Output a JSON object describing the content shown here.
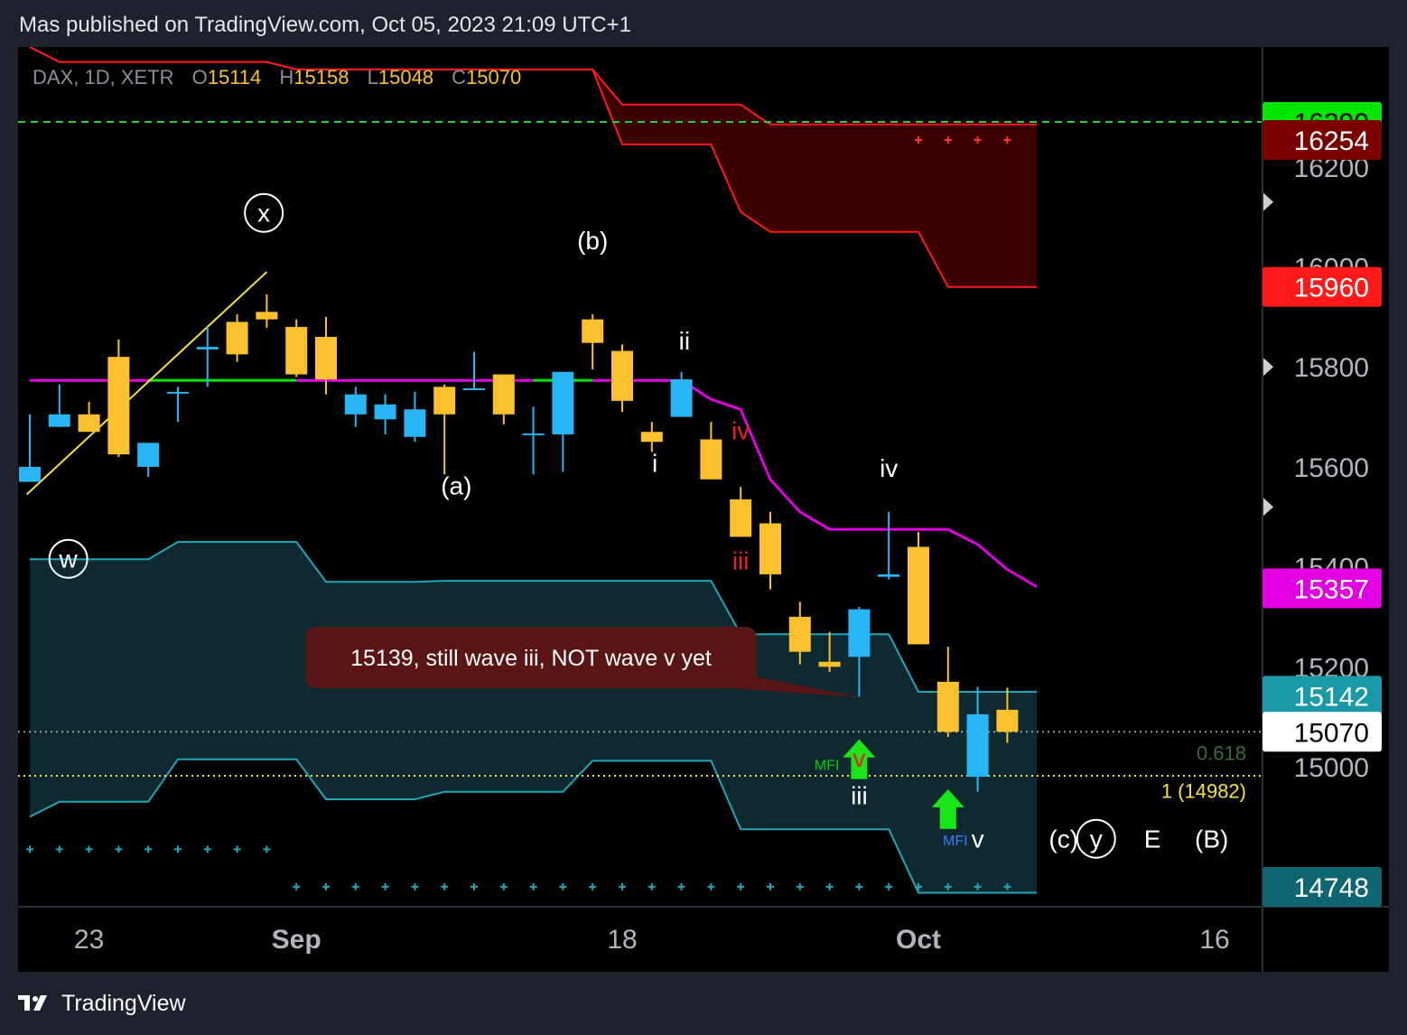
{
  "header": {
    "published": "Mas published on TradingView.com, Oct 05, 2023 21:09 UTC+1"
  },
  "legend": {
    "symbol": "DAX, 1D, XETR",
    "open_label": "O",
    "open": "15114",
    "high_label": "H",
    "high": "15158",
    "low_label": "L",
    "low": "15048",
    "close_label": "C",
    "close": "15070"
  },
  "footer": {
    "brand": "TradingView",
    "logo_icon": "tradingview-logo-icon"
  },
  "colors": {
    "bull": "#29b6f6",
    "bear": "#fbc02d",
    "cloud_top": "#3d0000",
    "cloud_bottom": "#0e2a30",
    "kijun": "#e100e1",
    "tenkan_green": "#00e600",
    "upper_line": "#ff1a1a",
    "lower_line": "#1ea7b8",
    "dashed_green": "#2ecc40",
    "fib_yellow": "#f5e23a"
  },
  "chart_data": {
    "type": "candlestick",
    "symbol": "DAX",
    "timeframe": "1D",
    "exchange": "XETR",
    "ylim": [
      14720,
      16440
    ],
    "y_ticks": [
      15000,
      15200,
      15400,
      15600,
      15800,
      16000,
      16200
    ],
    "x_ticks": [
      {
        "label": "23",
        "index": 2
      },
      {
        "label": "Sep",
        "index": 9
      },
      {
        "label": "18",
        "index": 20
      },
      {
        "label": "Oct",
        "index": 30
      },
      {
        "label": "16",
        "index": 40
      }
    ],
    "candles": [
      {
        "o": 15570,
        "h": 15705,
        "l": 15570,
        "c": 15600
      },
      {
        "o": 15680,
        "h": 15765,
        "l": 15680,
        "c": 15705
      },
      {
        "o": 15705,
        "h": 15730,
        "l": 15675,
        "c": 15670
      },
      {
        "o": 15820,
        "h": 15855,
        "l": 15620,
        "c": 15625
      },
      {
        "o": 15600,
        "h": 15620,
        "l": 15580,
        "c": 15648
      },
      {
        "o": 15750,
        "h": 15760,
        "l": 15690,
        "c": 15750
      },
      {
        "o": 15835,
        "h": 15880,
        "l": 15760,
        "c": 15840
      },
      {
        "o": 15890,
        "h": 15905,
        "l": 15810,
        "c": 15825
      },
      {
        "o": 15910,
        "h": 15945,
        "l": 15878,
        "c": 15895
      },
      {
        "o": 15880,
        "h": 15895,
        "l": 15780,
        "c": 15785
      },
      {
        "o": 15860,
        "h": 15900,
        "l": 15745,
        "c": 15775
      },
      {
        "o": 15705,
        "h": 15760,
        "l": 15680,
        "c": 15745
      },
      {
        "o": 15695,
        "h": 15745,
        "l": 15665,
        "c": 15725
      },
      {
        "o": 15660,
        "h": 15750,
        "l": 15650,
        "c": 15715
      },
      {
        "o": 15760,
        "h": 15765,
        "l": 15585,
        "c": 15705
      },
      {
        "o": 15755,
        "h": 15830,
        "l": 15755,
        "c": 15757
      },
      {
        "o": 15785,
        "h": 15785,
        "l": 15685,
        "c": 15705
      },
      {
        "o": 15665,
        "h": 15720,
        "l": 15585,
        "c": 15667
      },
      {
        "o": 15665,
        "h": 15780,
        "l": 15590,
        "c": 15790
      },
      {
        "o": 15895,
        "h": 15905,
        "l": 15795,
        "c": 15848
      },
      {
        "o": 15832,
        "h": 15845,
        "l": 15710,
        "c": 15732
      },
      {
        "o": 15670,
        "h": 15690,
        "l": 15630,
        "c": 15650
      },
      {
        "o": 15700,
        "h": 15790,
        "l": 15700,
        "c": 15775
      },
      {
        "o": 15655,
        "h": 15690,
        "l": 15600,
        "c": 15575
      },
      {
        "o": 15535,
        "h": 15560,
        "l": 15460,
        "c": 15460
      },
      {
        "o": 15487,
        "h": 15510,
        "l": 15355,
        "c": 15385
      },
      {
        "o": 15300,
        "h": 15330,
        "l": 15205,
        "c": 15230
      },
      {
        "o": 15210,
        "h": 15270,
        "l": 15190,
        "c": 15200
      },
      {
        "o": 15220,
        "h": 15320,
        "l": 15140,
        "c": 15315
      },
      {
        "o": 15380,
        "h": 15510,
        "l": 15375,
        "c": 15385
      },
      {
        "o": 15440,
        "h": 15470,
        "l": 15250,
        "c": 15245
      },
      {
        "o": 15170,
        "h": 15240,
        "l": 15060,
        "c": 15070
      },
      {
        "o": 14980,
        "h": 15160,
        "l": 14950,
        "c": 15105
      },
      {
        "o": 15114,
        "h": 15158,
        "l": 15048,
        "c": 15070
      }
    ],
    "tenkan_line": {
      "green_segments": [
        [
          4,
          9
        ],
        [
          17,
          19
        ]
      ]
    },
    "kijun_line": {
      "values": [
        [
          0,
          15773
        ],
        [
          1,
          15773
        ],
        [
          2,
          15773
        ],
        [
          3,
          15773
        ],
        [
          4,
          15773
        ],
        [
          5,
          15773
        ],
        [
          6,
          15773
        ],
        [
          7,
          15773
        ],
        [
          8,
          15773
        ],
        [
          9,
          15773
        ],
        [
          10,
          15773
        ],
        [
          11,
          15773
        ],
        [
          12,
          15773
        ],
        [
          13,
          15773
        ],
        [
          14,
          15773
        ],
        [
          15,
          15773
        ],
        [
          16,
          15773
        ],
        [
          17,
          15773
        ],
        [
          18,
          15773
        ],
        [
          19,
          15773
        ],
        [
          20,
          15773
        ],
        [
          21,
          15773
        ],
        [
          22,
          15773
        ],
        [
          23,
          15735
        ],
        [
          24,
          15715
        ],
        [
          25,
          15575
        ],
        [
          26,
          15510
        ],
        [
          27,
          15475
        ],
        [
          28,
          15475
        ],
        [
          29,
          15475
        ],
        [
          30,
          15475
        ],
        [
          31,
          15475
        ],
        [
          32,
          15445
        ],
        [
          33,
          15395
        ],
        [
          34,
          15360
        ]
      ]
    },
    "upper_band": {
      "upper": [
        [
          0,
          16440
        ],
        [
          1,
          16410
        ],
        [
          2,
          16410
        ],
        [
          3,
          16410
        ],
        [
          4,
          16410
        ],
        [
          5,
          16410
        ],
        [
          6,
          16410
        ],
        [
          7,
          16410
        ],
        [
          8,
          16410
        ],
        [
          9,
          16395
        ],
        [
          10,
          16395
        ],
        [
          11,
          16395
        ],
        [
          12,
          16395
        ],
        [
          13,
          16395
        ],
        [
          14,
          16395
        ],
        [
          15,
          16395
        ],
        [
          16,
          16395
        ],
        [
          17,
          16395
        ],
        [
          18,
          16395
        ],
        [
          19,
          16395
        ],
        [
          20,
          16325
        ],
        [
          21,
          16325
        ],
        [
          22,
          16325
        ],
        [
          23,
          16325
        ],
        [
          24,
          16325
        ],
        [
          25,
          16285
        ],
        [
          26,
          16285
        ],
        [
          27,
          16285
        ],
        [
          28,
          16285
        ],
        [
          29,
          16285
        ],
        [
          30,
          16285
        ],
        [
          31,
          16285
        ],
        [
          32,
          16285
        ],
        [
          33,
          16285
        ],
        [
          34,
          16285
        ]
      ],
      "lower": [
        [
          0,
          16440
        ],
        [
          1,
          16410
        ],
        [
          2,
          16410
        ],
        [
          3,
          16410
        ],
        [
          4,
          16410
        ],
        [
          5,
          16410
        ],
        [
          6,
          16410
        ],
        [
          7,
          16410
        ],
        [
          8,
          16410
        ],
        [
          9,
          16395
        ],
        [
          10,
          16395
        ],
        [
          11,
          16395
        ],
        [
          12,
          16395
        ],
        [
          13,
          16395
        ],
        [
          14,
          16395
        ],
        [
          15,
          16395
        ],
        [
          16,
          16395
        ],
        [
          17,
          16395
        ],
        [
          18,
          16395
        ],
        [
          19,
          16395
        ],
        [
          20,
          16245
        ],
        [
          21,
          16245
        ],
        [
          22,
          16245
        ],
        [
          23,
          16245
        ],
        [
          24,
          16110
        ],
        [
          25,
          16070
        ],
        [
          26,
          16070
        ],
        [
          27,
          16070
        ],
        [
          28,
          16070
        ],
        [
          29,
          16070
        ],
        [
          30,
          16070
        ],
        [
          31,
          15960
        ],
        [
          32,
          15960
        ],
        [
          33,
          15960
        ],
        [
          34,
          15960
        ]
      ]
    },
    "lower_band": {
      "upper": [
        [
          0,
          15415
        ],
        [
          1,
          15415
        ],
        [
          2,
          15415
        ],
        [
          3,
          15415
        ],
        [
          4,
          15415
        ],
        [
          5,
          15450
        ],
        [
          6,
          15450
        ],
        [
          7,
          15450
        ],
        [
          8,
          15450
        ],
        [
          9,
          15450
        ],
        [
          10,
          15370
        ],
        [
          11,
          15370
        ],
        [
          12,
          15370
        ],
        [
          13,
          15370
        ],
        [
          14,
          15372
        ],
        [
          15,
          15372
        ],
        [
          16,
          15372
        ],
        [
          17,
          15372
        ],
        [
          18,
          15372
        ],
        [
          19,
          15372
        ],
        [
          20,
          15372
        ],
        [
          21,
          15372
        ],
        [
          22,
          15372
        ],
        [
          23,
          15372
        ],
        [
          24,
          15265
        ],
        [
          25,
          15265
        ],
        [
          26,
          15265
        ],
        [
          27,
          15265
        ],
        [
          28,
          15265
        ],
        [
          29,
          15265
        ],
        [
          30,
          15150
        ],
        [
          31,
          15150
        ],
        [
          32,
          15150
        ],
        [
          33,
          15150
        ],
        [
          34,
          15150
        ]
      ],
      "lower": [
        [
          0,
          14900
        ],
        [
          1,
          14930
        ],
        [
          2,
          14930
        ],
        [
          3,
          14930
        ],
        [
          4,
          14930
        ],
        [
          5,
          15015
        ],
        [
          6,
          15015
        ],
        [
          7,
          15015
        ],
        [
          8,
          15015
        ],
        [
          9,
          15015
        ],
        [
          10,
          14935
        ],
        [
          11,
          14935
        ],
        [
          12,
          14935
        ],
        [
          13,
          14935
        ],
        [
          14,
          14950
        ],
        [
          15,
          14950
        ],
        [
          16,
          14950
        ],
        [
          17,
          14950
        ],
        [
          18,
          14950
        ],
        [
          19,
          15012
        ],
        [
          20,
          15012
        ],
        [
          21,
          15012
        ],
        [
          22,
          15012
        ],
        [
          23,
          15012
        ],
        [
          24,
          14875
        ],
        [
          25,
          14875
        ],
        [
          26,
          14875
        ],
        [
          27,
          14875
        ],
        [
          28,
          14875
        ],
        [
          29,
          14875
        ],
        [
          30,
          14748
        ],
        [
          31,
          14748
        ],
        [
          32,
          14748
        ],
        [
          33,
          14748
        ],
        [
          34,
          14748
        ]
      ]
    },
    "horizontal_lines": [
      {
        "name": "dashed-green-level",
        "value": 16290,
        "style": "dashed",
        "color": "#2ecc40"
      },
      {
        "name": "last-price-line",
        "value": 15070,
        "style": "dotted",
        "color": "#9a9a9a"
      },
      {
        "name": "fib-1-level",
        "value": 14982,
        "style": "dotted",
        "color": "#f5e23a"
      }
    ],
    "trend_line": {
      "from": [
        -0.1,
        15545
      ],
      "to": [
        8,
        15990
      ]
    },
    "price_labels": [
      {
        "value": "16290",
        "price": 16290,
        "bg": "#00e600",
        "fg": "#000000"
      },
      {
        "value": "16254",
        "price": 16254,
        "bg": "#7a0000",
        "fg": "#ffffff"
      },
      {
        "value": "15960",
        "price": 15960,
        "bg": "#ff1a1a",
        "fg": "#ffffff"
      },
      {
        "value": "15357",
        "price": 15357,
        "bg": "#e100e1",
        "fg": "#ffffff"
      },
      {
        "value": "15142",
        "price": 15142,
        "bg": "#1a9aa8",
        "fg": "#ffffff"
      },
      {
        "value": "15070",
        "price": 15070,
        "bg": "#ffffff",
        "fg": "#000000"
      },
      {
        "value": "14748",
        "price": 14748,
        "bg": "#0f6670",
        "fg": "#ffffff"
      }
    ],
    "fib_labels": [
      {
        "text": "0.618",
        "price": 15028,
        "color": "#3b6b3b"
      },
      {
        "text": "1 (14982)",
        "price": 14952,
        "color": "#f5e23a"
      }
    ],
    "wave_labels": [
      {
        "text": "x",
        "index": 7.9,
        "price": 16090,
        "color": "#ffffff",
        "circled": true
      },
      {
        "text": "w",
        "index": 1.3,
        "price": 15398,
        "color": "#ffffff",
        "circled": true
      },
      {
        "text": "(b)",
        "index": 19,
        "price": 16035,
        "color": "#ffffff"
      },
      {
        "text": "ii",
        "index": 22.1,
        "price": 15835,
        "color": "#ffffff"
      },
      {
        "text": "(a)",
        "index": 14.4,
        "price": 15545,
        "color": "#ffffff"
      },
      {
        "text": "i",
        "index": 21.1,
        "price": 15590,
        "color": "#ffffff"
      },
      {
        "text": "iv",
        "index": 24,
        "price": 15655,
        "color": "#e82020"
      },
      {
        "text": "iii",
        "index": 24,
        "price": 15395,
        "color": "#e82020"
      },
      {
        "text": "iv",
        "index": 29,
        "price": 15580,
        "color": "#ffffff"
      },
      {
        "text": "v",
        "index": 28,
        "price": 15000,
        "color": "#e82020"
      },
      {
        "text": "iii",
        "index": 28,
        "price": 14925,
        "color": "#ffffff"
      },
      {
        "text": "v",
        "index": 32,
        "price": 14838,
        "color": "#ffffff"
      },
      {
        "text": "(c)",
        "index": 34.9,
        "price": 14838,
        "color": "#ffffff"
      },
      {
        "text": "y",
        "index": 36,
        "price": 14838,
        "color": "#ffffff",
        "circled": true
      },
      {
        "text": "E",
        "index": 37.9,
        "price": 14838,
        "color": "#ffffff"
      },
      {
        "text": "(B)",
        "index": 39.9,
        "price": 14838,
        "color": "#ffffff"
      }
    ],
    "signals": [
      {
        "type": "arrow-up",
        "index": 28,
        "price": 15055,
        "label": "MFI",
        "label_color": "#00cc00",
        "label_side": "left"
      },
      {
        "type": "arrow-up",
        "index": 31,
        "price": 14955,
        "label": "MFI",
        "label_color": "#3a7bff",
        "label_side": "below"
      }
    ],
    "cross_markers": [
      {
        "row": "top",
        "price": 16254,
        "indices": [
          30,
          31,
          32,
          33
        ]
      },
      {
        "row": "mid",
        "price": 14835,
        "indices": [
          0,
          1,
          2,
          3,
          4,
          5,
          6,
          7,
          8
        ]
      },
      {
        "row": "bottom",
        "price": 14760,
        "indices": [
          9,
          10,
          11,
          12,
          13,
          14,
          15,
          16,
          17,
          18,
          19,
          20,
          21,
          22,
          23,
          24,
          25,
          26,
          27,
          28,
          29,
          30,
          31,
          32,
          33
        ]
      }
    ],
    "annotation": {
      "text": "15139, still wave iii, NOT wave v yet",
      "anchor_index": 28,
      "anchor_price": 15139
    }
  }
}
